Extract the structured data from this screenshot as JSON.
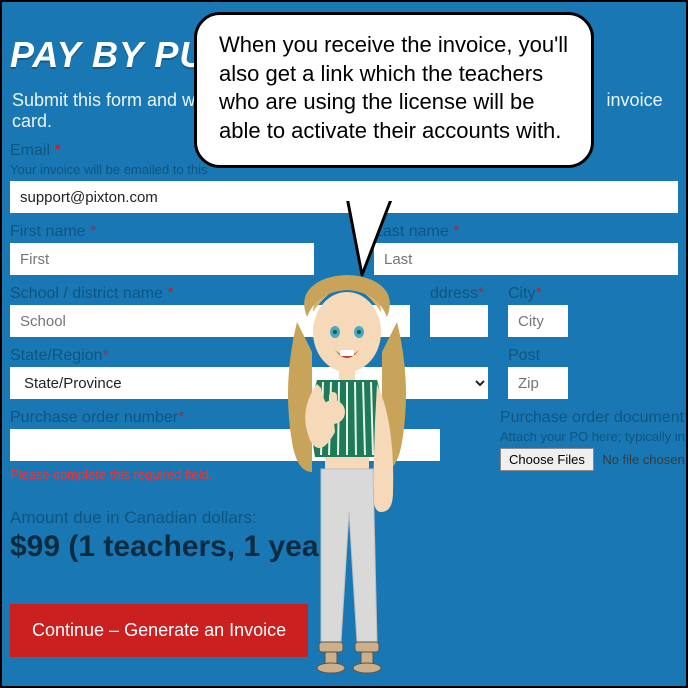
{
  "header": {
    "title": "PAY BY PURCHASE ORDER",
    "subtitle_left": "Submit this form and we'll",
    "subtitle_right": "invoice card."
  },
  "form": {
    "email": {
      "label": "Email",
      "hint": "Your invoice will be emailed to this",
      "value": "support@pixton.com"
    },
    "first_name": {
      "label": "First name",
      "placeholder": "First"
    },
    "last_name": {
      "label": "Last name",
      "placeholder": "Last"
    },
    "school": {
      "label": "School / district name",
      "placeholder": "School"
    },
    "address": {
      "label_fragment": "ddress"
    },
    "city": {
      "label": "City",
      "placeholder": "City"
    },
    "state": {
      "label": "State/Region",
      "placeholder": "State/Province"
    },
    "postal": {
      "label_fragment": "Post",
      "placeholder": "Zip"
    },
    "po_number": {
      "label": "Purchase order number",
      "error": "Please complete this required field."
    },
    "po_document": {
      "label": "Purchase order document",
      "hint": "Attach your PO here; typically in PDF format",
      "button": "Choose Files",
      "status": "No file chosen"
    },
    "amount": {
      "label": "Amount due in Canadian dollars:",
      "value": "$99 (1 teachers, 1 year)"
    },
    "submit": "Continue – Generate an Invoice"
  },
  "bubble": {
    "text": "When you receive the invoice, you'll also get a link which the teachers who are using the license will be able to activate their accounts with."
  },
  "required_marker": "*"
}
